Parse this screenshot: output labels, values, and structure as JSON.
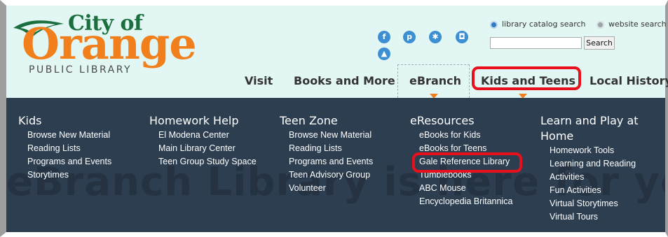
{
  "logo": {
    "line1": "City of",
    "line2": "Orange",
    "line3": "PUBLIC LIBRARY"
  },
  "social": [
    {
      "icon": "facebook-icon",
      "glyph": "f"
    },
    {
      "icon": "pinterest-icon",
      "glyph": "p"
    },
    {
      "icon": "yelp-icon",
      "glyph": "✱"
    },
    {
      "icon": "instagram-icon",
      "glyph": "◘"
    },
    {
      "icon": "hat-icon",
      "glyph": "▲"
    }
  ],
  "search": {
    "option_catalog": "library catalog search",
    "option_website": "website search",
    "input_value": "",
    "button_label": "Search"
  },
  "nav": [
    "Visit",
    "Books and More",
    "eBranch",
    "Kids and Teens",
    "Local History"
  ],
  "menu": {
    "columns": [
      {
        "title": "Kids",
        "items": [
          "Browse New Material",
          "Reading Lists",
          "Programs and Events",
          "Storytimes"
        ]
      },
      {
        "title": "Homework Help",
        "items": [
          "El Modena Center",
          "Main Library Center",
          "Teen Group Study Space"
        ]
      },
      {
        "title": "Teen Zone",
        "items": [
          "Browse New Material",
          "Reading Lists",
          "Programs and Events",
          "Teen Advisory Group",
          "Volunteer"
        ]
      },
      {
        "title": "eResources",
        "items": [
          "eBooks for Kids",
          "eBooks for Teens",
          "Gale Reference Library",
          "Tumblebooks",
          "ABC Mouse",
          "Encyclopedia Britannica"
        ]
      },
      {
        "title_line1": "Learn and Play at",
        "title_line2": "Home",
        "items": [
          "Homework Tools",
          "Learning and Reading",
          "Activities",
          "Fun Activities",
          "Virtual Storytimes",
          "Virtual Tours"
        ]
      }
    ]
  },
  "colors": {
    "header_bg": "#e2f6f3",
    "menu_bg": "#2c3e50",
    "accent_orange": "#f07f1c",
    "highlight_red": "#e8101c",
    "social_blue": "#3c8fd2"
  }
}
